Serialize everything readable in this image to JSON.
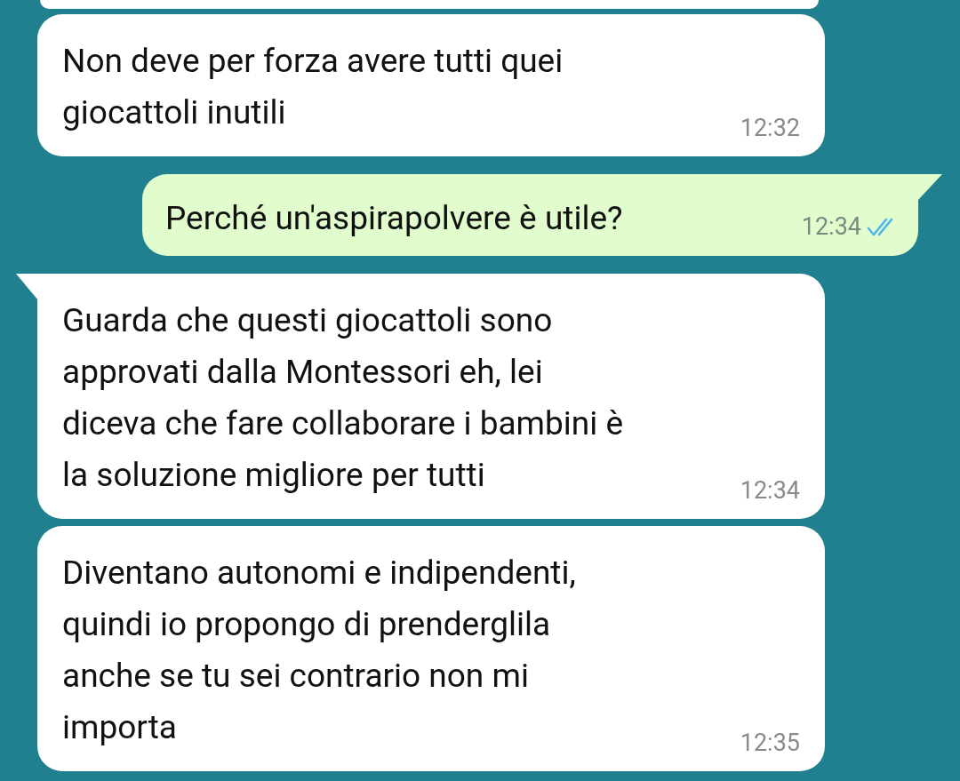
{
  "messages": [
    {
      "outgoing": false,
      "tail": false,
      "text": "Non deve per forza avere tutti quei\ngiocattoli inutili",
      "time": "12:32"
    },
    {
      "outgoing": true,
      "tail": true,
      "text": "Perché un'aspirapolvere è utile?",
      "time": "12:34",
      "read": true
    },
    {
      "outgoing": false,
      "tail": true,
      "text": "Guarda che questi giocattoli sono\napprovati dalla Montessori eh, lei\ndiceva che fare collaborare i bambini è\nla soluzione migliore per tutti",
      "time": "12:34"
    },
    {
      "outgoing": false,
      "tail": false,
      "text": "Diventano autonomi e indipendenti,\nquindi io propongo di prenderglila\nanche se tu sei contrario non mi\nimporta",
      "time": "12:35"
    }
  ]
}
